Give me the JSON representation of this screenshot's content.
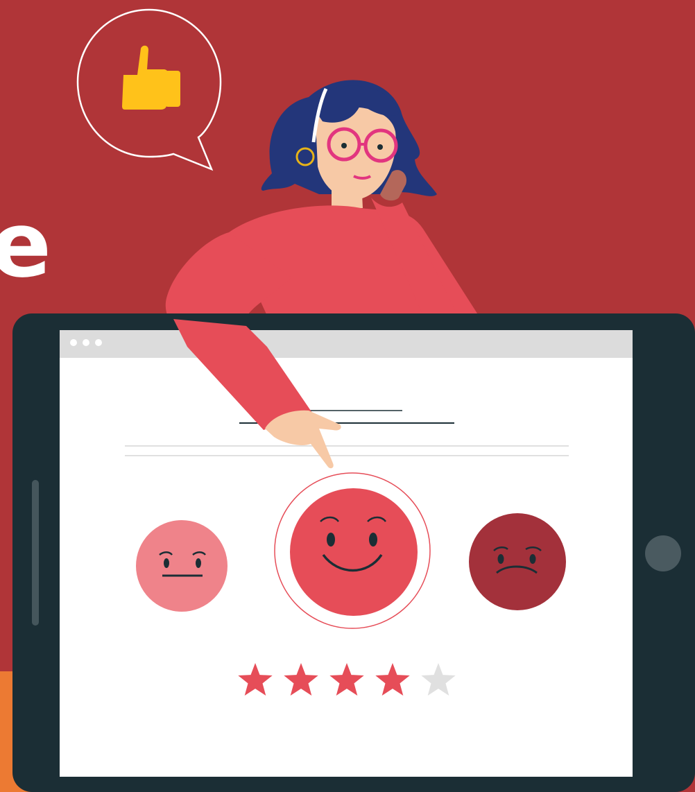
{
  "background": {
    "color": "#b03538",
    "accent_band_color": "#ec7a33",
    "partial_word_fragment": "e"
  },
  "speech_bubble": {
    "icon": "thumbs-up-icon",
    "icon_color": "#ffc21a"
  },
  "tablet": {
    "frame_color": "#1b2e35",
    "browser_dots": 3,
    "home_button": "home-button"
  },
  "rating": {
    "faces": [
      {
        "name": "neutral-face-icon",
        "mood": "neutral",
        "color": "#ef838a"
      },
      {
        "name": "happy-face-icon",
        "mood": "happy",
        "color": "#e64d58",
        "selected": true
      },
      {
        "name": "sad-face-icon",
        "mood": "sad",
        "color": "#a3313b"
      }
    ],
    "stars_total": 5,
    "stars_filled": 4,
    "star_color": "#e64d58",
    "star_empty_color": "#e0e0e0"
  }
}
